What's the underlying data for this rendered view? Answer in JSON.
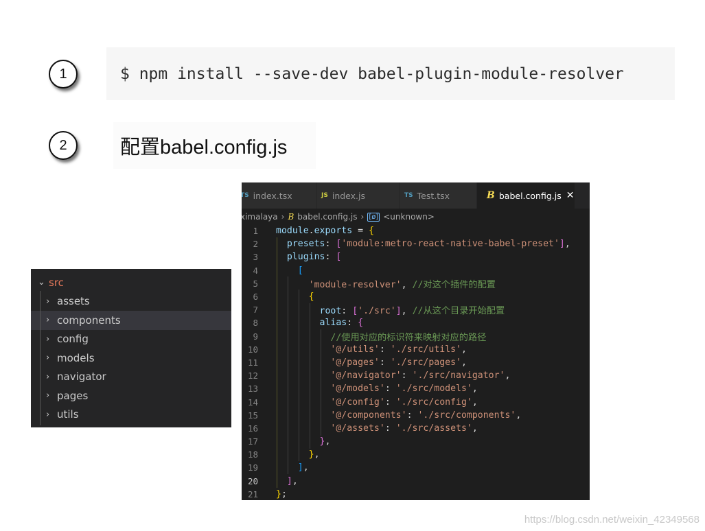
{
  "steps": [
    {
      "number": "1",
      "command": "$ npm install --save-dev babel-plugin-module-resolver"
    },
    {
      "number": "2",
      "title": "配置babel.config.js"
    }
  ],
  "explorer": {
    "root": "src",
    "folders": [
      "assets",
      "components",
      "config",
      "models",
      "navigator",
      "pages",
      "utils"
    ],
    "selected": "components"
  },
  "editor": {
    "tabs": [
      {
        "icon": "TS",
        "label": "index.tsx"
      },
      {
        "icon": "JS",
        "label": "index.js"
      },
      {
        "icon": "TS",
        "label": "Test.tsx"
      },
      {
        "icon": "B",
        "label": "babel.config.js",
        "active": true
      }
    ],
    "breadcrumb": [
      "ximalaya",
      "babel.config.js",
      "<unknown>"
    ],
    "current_line": 20,
    "lines": [
      "module.exports = {",
      "  presets: ['module:metro-react-native-babel-preset'],",
      "  plugins: [",
      "    [",
      "      'module-resolver', //对这个插件的配置",
      "      {",
      "        root: ['./src'], //从这个目录开始配置",
      "        alias: {",
      "          //使用对应的标识符来映射对应的路径",
      "          '@/utils': './src/utils',",
      "          '@/pages': './src/pages',",
      "          '@/navigator': './src/navigator',",
      "          '@/models': './src/models',",
      "          '@/config': './src/config',",
      "          '@/components': './src/components',",
      "          '@/assets': './src/assets',",
      "        },",
      "      },",
      "    ],",
      "  ],",
      "};"
    ]
  },
  "watermark": "https://blog.csdn.net/weixin_42349568",
  "colors": {
    "explorer_bg": "#252526",
    "editor_bg": "#1e1e1e",
    "string": "#ce9178",
    "comment": "#6a9955",
    "property": "#9cdcfe"
  }
}
